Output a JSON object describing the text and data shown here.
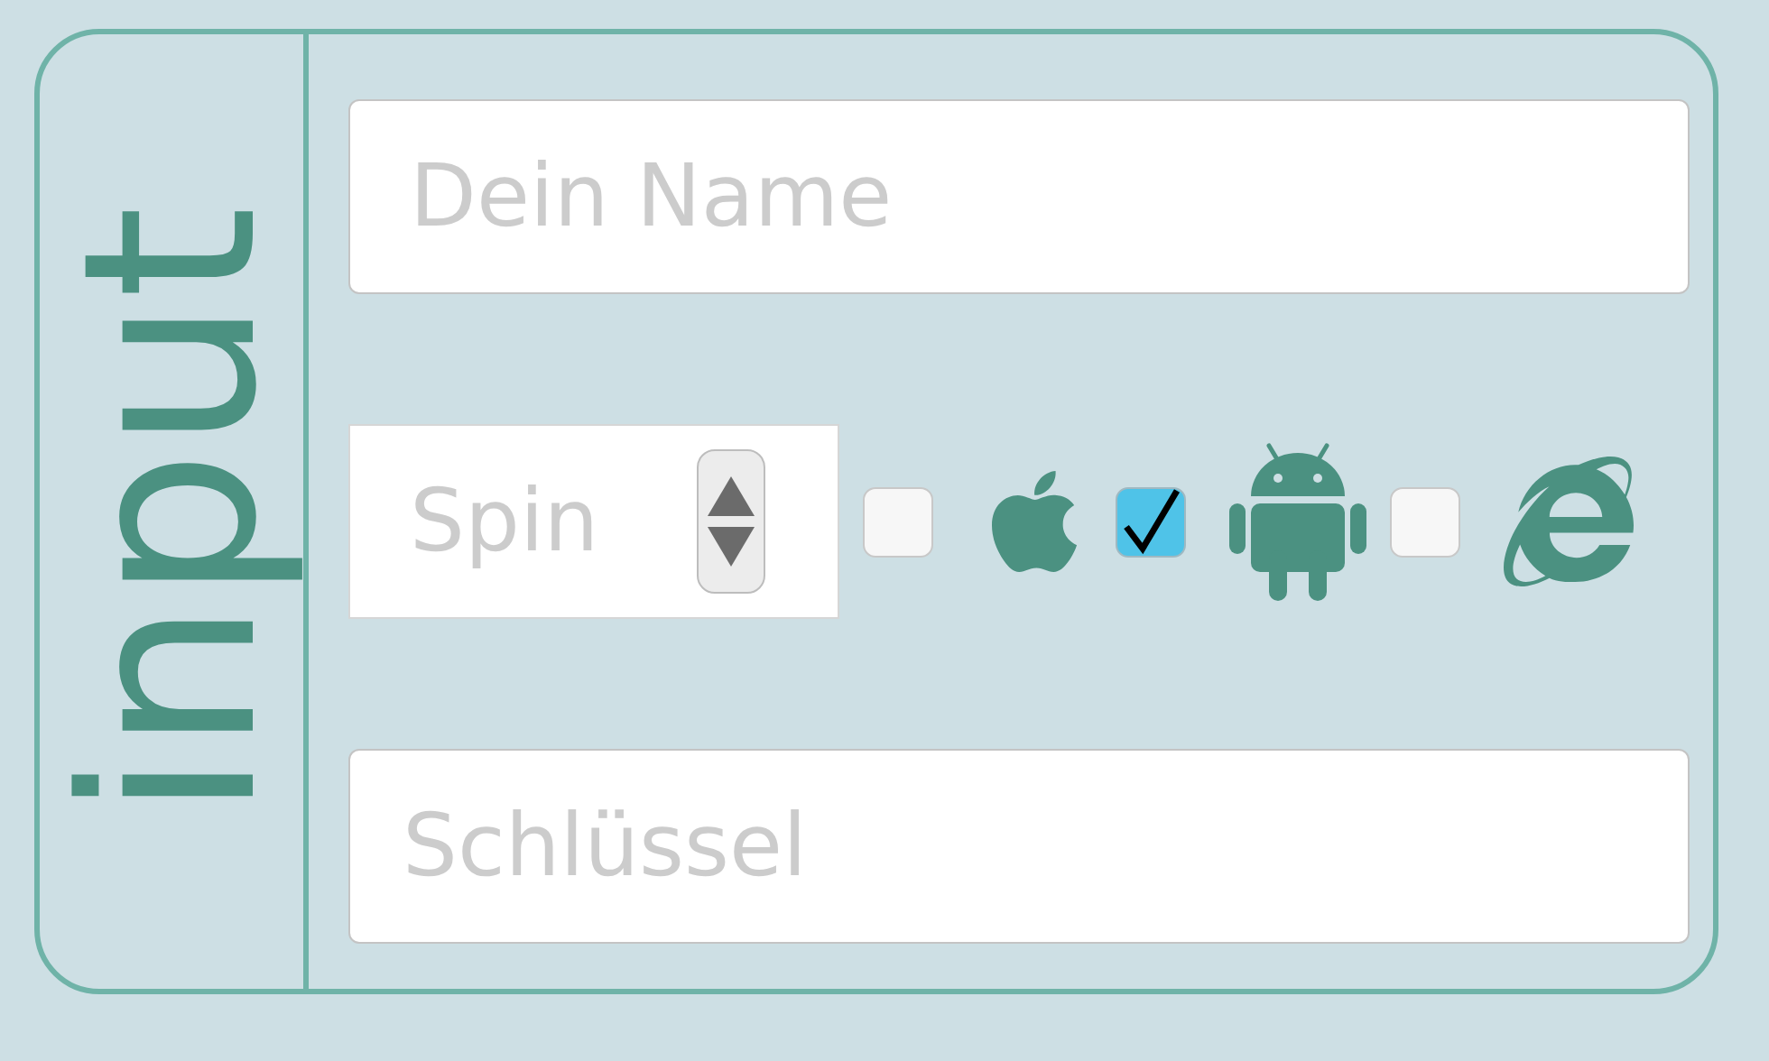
{
  "panel": {
    "title": "input"
  },
  "name_field": {
    "placeholder": "Dein Name"
  },
  "spin_field": {
    "placeholder": "Spin"
  },
  "platforms": [
    {
      "kind": "apple",
      "checked": false
    },
    {
      "kind": "android",
      "checked": true
    },
    {
      "kind": "explorer",
      "checked": false
    }
  ],
  "key_field": {
    "placeholder": "Schlüssel"
  }
}
